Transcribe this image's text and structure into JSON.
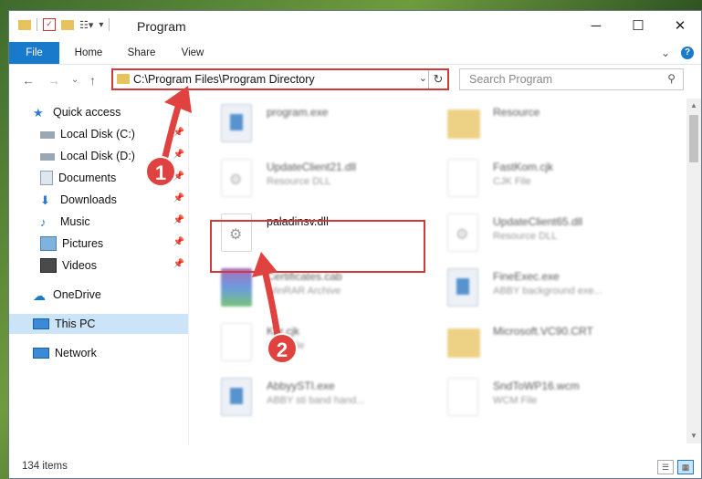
{
  "window": {
    "title": "Program",
    "controls": {
      "minimize": "─",
      "maximize": "☐",
      "close": "✕"
    }
  },
  "ribbon": {
    "tabs": [
      "File",
      "Home",
      "Share",
      "View"
    ]
  },
  "navigation": {
    "address_path": "C:\\Program Files\\Program Directory",
    "search_placeholder": "Search Program"
  },
  "sidebar": {
    "items": [
      {
        "label": "Quick access",
        "icon": "star-icon"
      },
      {
        "label": "Local Disk (C:)",
        "icon": "drive-icon"
      },
      {
        "label": "Local Disk (D:)",
        "icon": "drive-icon"
      },
      {
        "label": "Documents",
        "icon": "documents-icon"
      },
      {
        "label": "Downloads",
        "icon": "download-icon"
      },
      {
        "label": "Music",
        "icon": "music-icon"
      },
      {
        "label": "Pictures",
        "icon": "pictures-icon"
      },
      {
        "label": "Videos",
        "icon": "videos-icon"
      },
      {
        "label": "OneDrive",
        "icon": "cloud-icon"
      },
      {
        "label": "This PC",
        "icon": "computer-icon"
      },
      {
        "label": "Network",
        "icon": "network-icon"
      }
    ]
  },
  "files": [
    {
      "name": "program.exe",
      "type": ""
    },
    {
      "name": "Resource",
      "type": ""
    },
    {
      "name": "UpdateClient21.dll",
      "type": "Resource DLL"
    },
    {
      "name": "FastKom.cjk",
      "type": "CJK File"
    },
    {
      "name": "paladinsv.dll",
      "type": ""
    },
    {
      "name": "UpdateClient65.dll",
      "type": "Resource DLL"
    },
    {
      "name": "Certificates.cab",
      "type": "WinRAR Archive"
    },
    {
      "name": "FineExec.exe",
      "type": "ABBY background exe..."
    },
    {
      "name": "Kor.cjk",
      "type": "CJK File"
    },
    {
      "name": "Microsoft.VC90.CRT",
      "type": ""
    },
    {
      "name": "AbbyySTI.exe",
      "type": "ABBY sti band hand..."
    },
    {
      "name": "SndToWP16.wcm",
      "type": "WCM File"
    }
  ],
  "status": {
    "item_count": "134 items"
  },
  "annotations": {
    "step1": "1",
    "step2": "2"
  }
}
